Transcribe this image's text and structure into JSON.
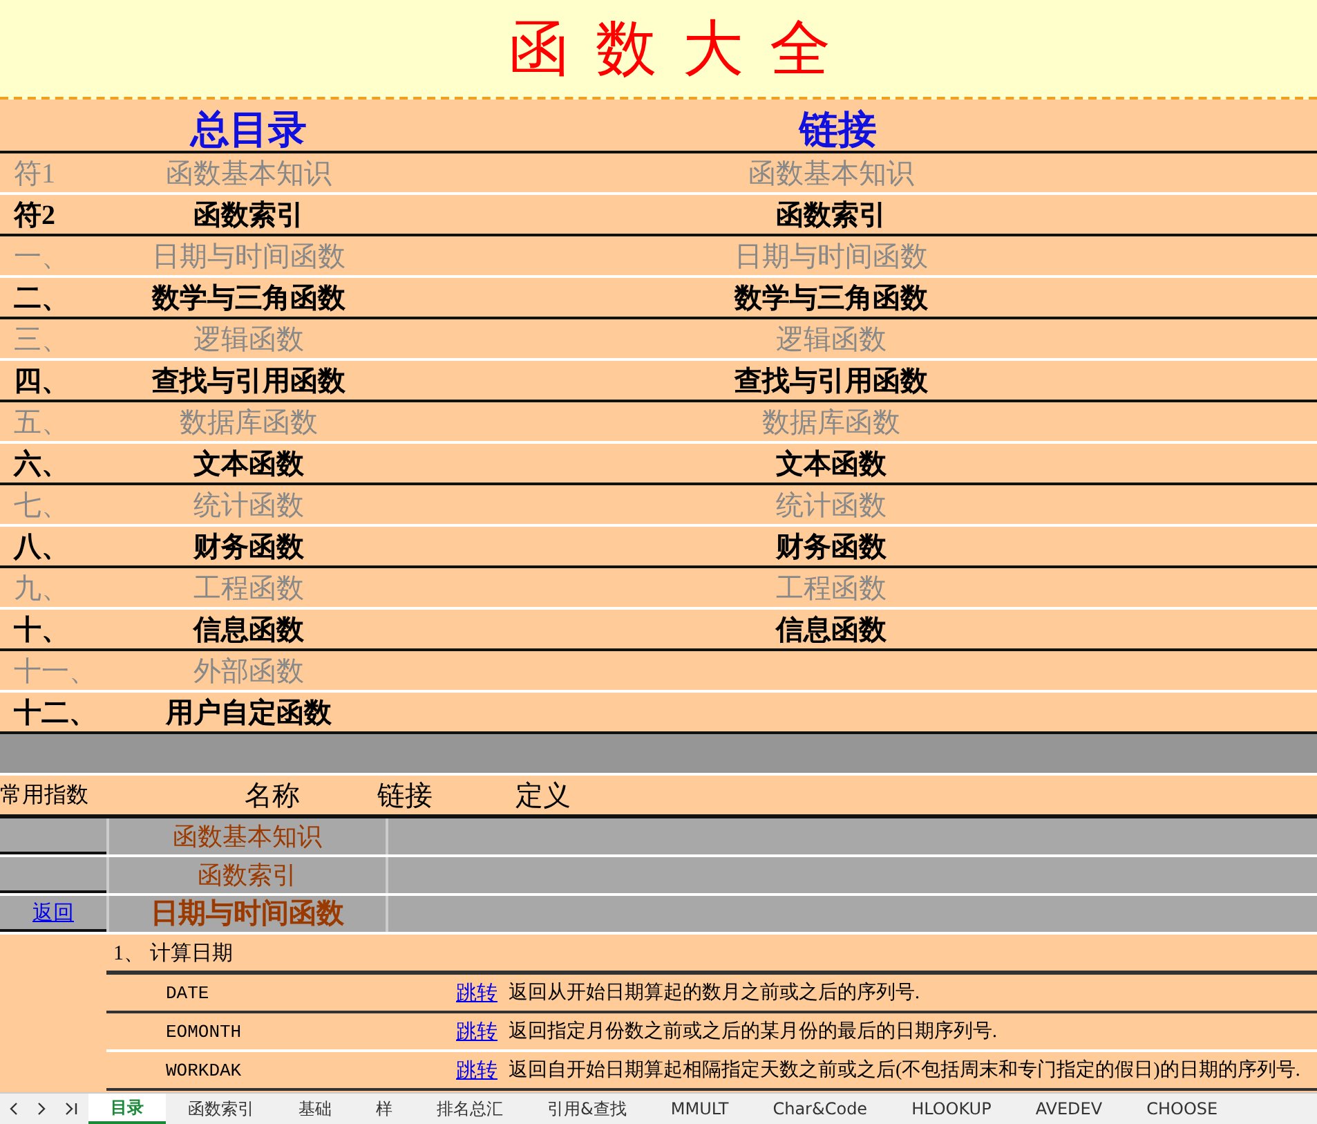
{
  "title": "函 数 大 全",
  "toc": {
    "header": "总目录",
    "link_header": "链接",
    "rows": [
      {
        "number": "符1",
        "name": "函数基本知识",
        "link": "函数基本知识",
        "muted": true
      },
      {
        "number": "符2",
        "name": "函数索引",
        "link": "函数索引",
        "muted": false
      },
      {
        "number": "一、",
        "name": "日期与时间函数",
        "link": "日期与时间函数",
        "muted": true
      },
      {
        "number": "二、",
        "name": "数学与三角函数",
        "link": "数学与三角函数",
        "muted": false
      },
      {
        "number": "三、",
        "name": "逻辑函数",
        "link": "逻辑函数",
        "muted": true
      },
      {
        "number": "四、",
        "name": "查找与引用函数",
        "link": "查找与引用函数",
        "muted": false
      },
      {
        "number": "五、",
        "name": "数据库函数",
        "link": "数据库函数",
        "muted": true
      },
      {
        "number": "六、",
        "name": "文本函数",
        "link": "文本函数",
        "muted": false
      },
      {
        "number": "七、",
        "name": "统计函数",
        "link": "统计函数",
        "muted": true
      },
      {
        "number": "八、",
        "name": "财务函数",
        "link": "财务函数",
        "muted": false
      },
      {
        "number": "九、",
        "name": "工程函数",
        "link": "工程函数",
        "muted": true
      },
      {
        "number": "十、",
        "name": "信息函数",
        "link": "信息函数",
        "muted": false
      },
      {
        "number": "十一、",
        "name": "外部函数",
        "muted": true
      },
      {
        "number": "十二、",
        "name": "用户自定函数",
        "muted": false
      }
    ]
  },
  "index": {
    "side_label": "常用指数",
    "columns": [
      "名称",
      "链接",
      "定义"
    ],
    "rows": [
      {
        "name": "函数基本知识",
        "bold": false
      },
      {
        "name": "函数索引",
        "bold": false
      },
      {
        "name": "日期与时间函数",
        "bold": true,
        "back_link": "返回"
      }
    ]
  },
  "section": {
    "heading": "1、 计算日期",
    "functions": [
      {
        "name": "DATE",
        "link": "跳转",
        "description": "返回从开始日期算起的数月之前或之后的序列号."
      },
      {
        "name": "EOMONTH",
        "link": "跳转",
        "description": "返回指定月份数之前或之后的某月份的最后的日期序列号."
      },
      {
        "name": "WORKDAK",
        "link": "跳转",
        "description": "返回自开始日期算起相隔指定天数之前或之后(不包括周末和专门指定的假日)的日期的序列号."
      }
    ]
  },
  "sheet_tabs": [
    {
      "label": "目录",
      "selected": true
    },
    {
      "label": "函数索引",
      "selected": false
    },
    {
      "label": "基础",
      "selected": false
    },
    {
      "label": "样",
      "selected": false
    },
    {
      "label": "排名总汇",
      "selected": false
    },
    {
      "label": "引用&查找",
      "selected": false
    },
    {
      "label": "MMULT",
      "selected": false
    },
    {
      "label": "Char&Code",
      "selected": false
    },
    {
      "label": "HLOOKUP",
      "selected": false
    },
    {
      "label": "AVEDEV",
      "selected": false
    },
    {
      "label": "CHOOSE",
      "selected": false
    }
  ]
}
